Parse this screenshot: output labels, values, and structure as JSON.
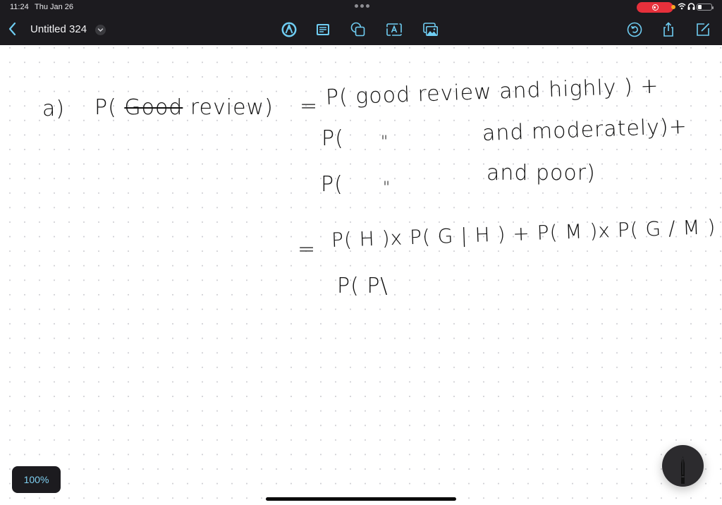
{
  "status_bar": {
    "time": "11:24",
    "date": "Thu Jan 26",
    "recording": true,
    "wifi_icon": "wifi-icon",
    "headphones_icon": "headphones-icon",
    "battery_level": "low"
  },
  "toolbar": {
    "back_icon": "chevron-left-icon",
    "document_title": "Untitled 324",
    "title_menu_icon": "chevron-down-icon",
    "center_tools": [
      {
        "name": "pen-tool",
        "icon": "pen-nib-icon",
        "active": true
      },
      {
        "name": "text-box",
        "icon": "text-lines-icon"
      },
      {
        "name": "shapes",
        "icon": "shapes-icon"
      },
      {
        "name": "text-label",
        "icon": "text-a-icon"
      },
      {
        "name": "media",
        "icon": "photo-icon"
      }
    ],
    "right_tools": [
      {
        "name": "undo-history",
        "icon": "undo-icon"
      },
      {
        "name": "share",
        "icon": "share-icon"
      },
      {
        "name": "new-note",
        "icon": "compose-icon"
      }
    ],
    "accent_color": "#6fcdf2",
    "bar_color": "#1c1b1f"
  },
  "canvas": {
    "background": "dot-grid",
    "handwriting": [
      {
        "id": "label",
        "text": "a)"
      },
      {
        "id": "lhs",
        "prefix": "P(",
        "struck": "Good",
        "suffix": " review)"
      },
      {
        "id": "eq1",
        "text": "="
      },
      {
        "id": "line1",
        "text": "P( good review and highly ) +"
      },
      {
        "id": "line2a",
        "text": "P("
      },
      {
        "id": "line2b",
        "text": "\""
      },
      {
        "id": "line2c",
        "text": "and moderately)+"
      },
      {
        "id": "line3a",
        "text": "P("
      },
      {
        "id": "line3b",
        "text": "\""
      },
      {
        "id": "line3c",
        "text": "and poor)"
      },
      {
        "id": "eq2",
        "text": "="
      },
      {
        "id": "line4",
        "text": "P( H )x P( G | H ) + P( M )x P( G / M ) +"
      },
      {
        "id": "line5",
        "text": "P( P\\"
      }
    ]
  },
  "zoom_level": "100%",
  "pencil_button_icon": "pencil-icon"
}
